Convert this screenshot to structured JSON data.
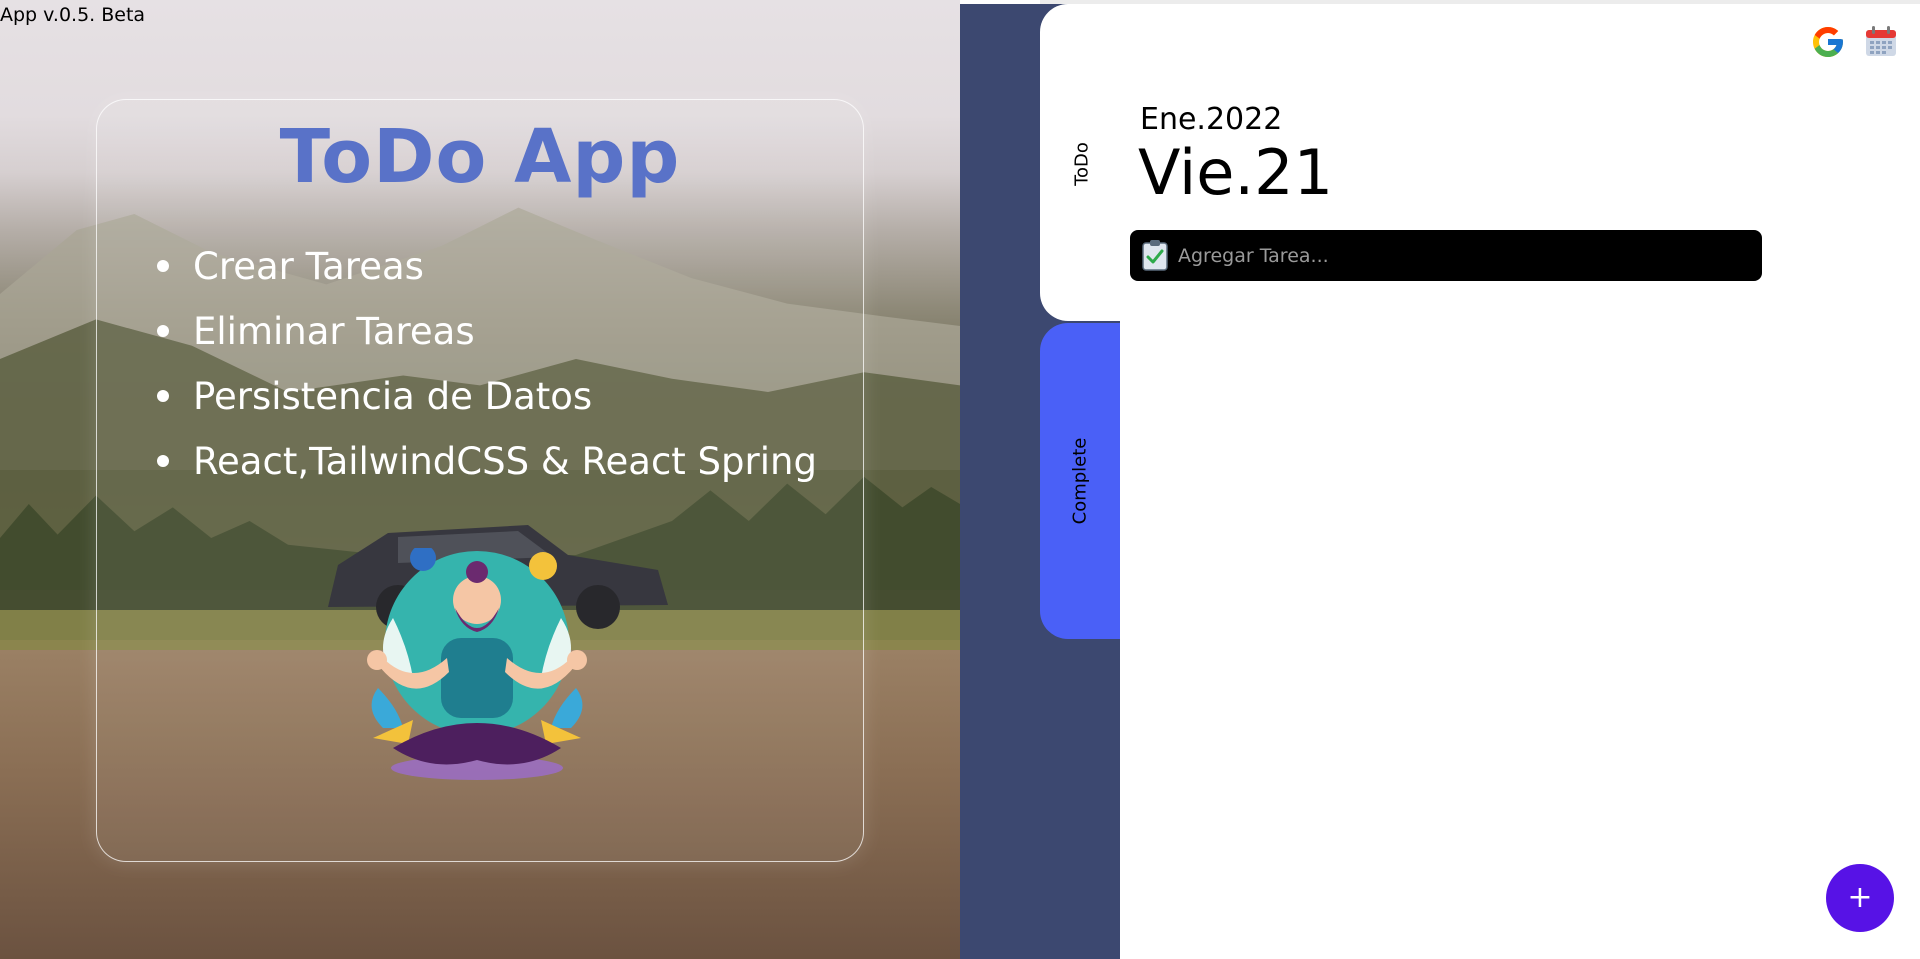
{
  "app": {
    "version_label": "App v.0.5. Beta"
  },
  "hero": {
    "title": "ToDo App",
    "features": [
      "Crear Tareas",
      "Eliminar Tareas",
      "Persistencia de Datos",
      "React,TailwindCSS & React Spring"
    ],
    "title_color": "#5972c8"
  },
  "tabs": [
    {
      "label": "ToDo",
      "active": true
    },
    {
      "label": "Complete",
      "active": false,
      "color": "#4a60f7"
    }
  ],
  "header": {
    "icons": [
      "google-icon",
      "calendar-icon"
    ]
  },
  "date": {
    "month_year": "Ene.2022",
    "day": "Vie.21"
  },
  "task_input": {
    "placeholder": "Agregar Tarea...",
    "value": "",
    "icon": "clipboard-check-icon"
  },
  "fab": {
    "label": "+",
    "color": "#5712e6"
  },
  "colors": {
    "nav_strip": "#3c4870",
    "complete_tab": "#4a60f7",
    "fab": "#5712e6",
    "title": "#5972c8"
  }
}
